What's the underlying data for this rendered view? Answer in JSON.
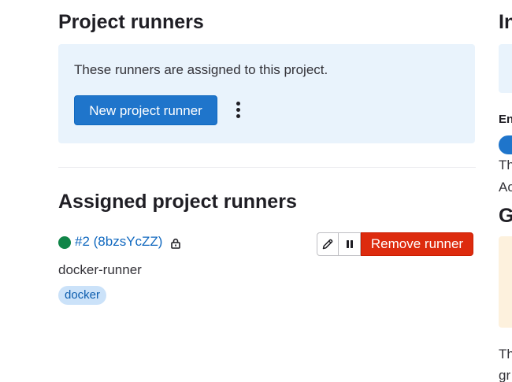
{
  "project_runners": {
    "title": "Project runners",
    "info_text": "These runners are assigned to this project.",
    "new_runner_button": "New project runner",
    "more_actions_icon": "vertical-ellipsis-icon"
  },
  "assigned": {
    "title": "Assigned project runners",
    "runners": [
      {
        "name": "#2 (8bzsYcZZ)",
        "status": "online",
        "status_color": "#108548",
        "locked_icon": "lock-icon",
        "description": "docker-runner",
        "tags": [
          "docker"
        ],
        "actions": {
          "edit_icon": "pencil-icon",
          "pause_icon": "pause-icon",
          "remove_label": "Remove runner"
        }
      }
    ]
  },
  "right_column": {
    "heading_1": "In",
    "label_1": "En",
    "text_1": "Th",
    "text_2": "Ac",
    "heading_2": "G",
    "text_3": "Th",
    "text_4": "gr"
  },
  "colors": {
    "primary": "#1f75cb",
    "danger": "#dd2b0e",
    "info_bg": "#e9f3fc",
    "link": "#1068bf",
    "tag_bg": "#cbe2f9"
  }
}
